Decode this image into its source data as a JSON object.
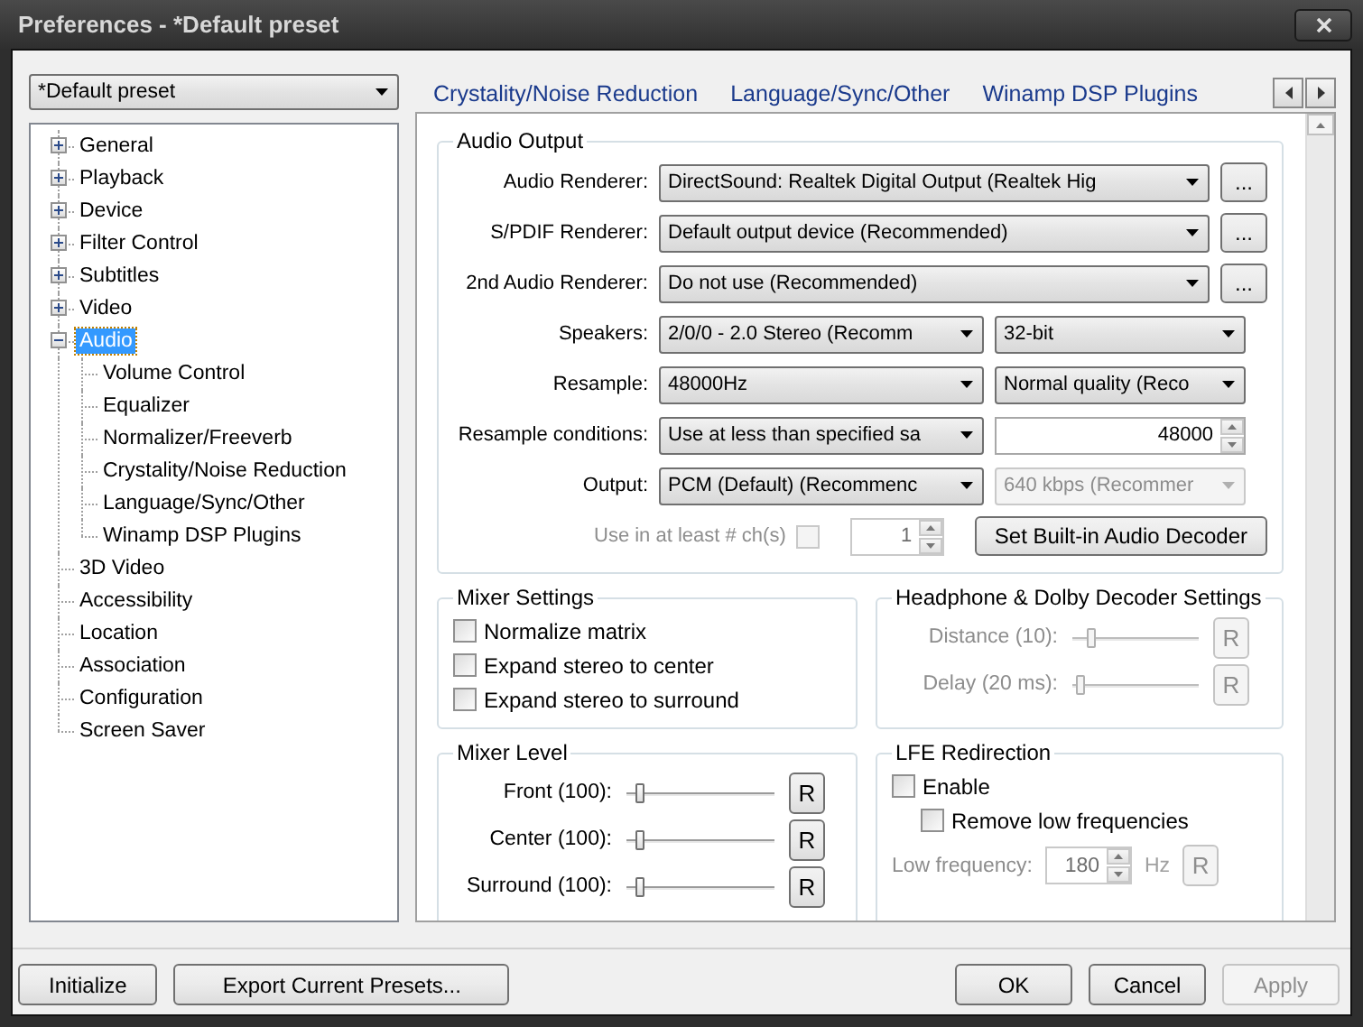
{
  "window": {
    "title": "Preferences - *Default preset"
  },
  "preset_select": {
    "value": "*Default preset"
  },
  "tree": [
    {
      "label": "General",
      "expanded": false,
      "selected": false
    },
    {
      "label": "Playback",
      "expanded": false,
      "selected": false
    },
    {
      "label": "Device",
      "expanded": false,
      "selected": false
    },
    {
      "label": "Filter Control",
      "expanded": false,
      "selected": false
    },
    {
      "label": "Subtitles",
      "expanded": false,
      "selected": false
    },
    {
      "label": "Video",
      "expanded": false,
      "selected": false
    },
    {
      "label": "Audio",
      "expanded": true,
      "selected": true,
      "children": [
        {
          "label": "Volume Control",
          "selected": false
        },
        {
          "label": "Equalizer",
          "selected": false
        },
        {
          "label": "Normalizer/Freeverb",
          "selected": false
        },
        {
          "label": "Crystality/Noise Reduction",
          "selected": false
        },
        {
          "label": "Language/Sync/Other",
          "selected": false
        },
        {
          "label": "Winamp DSP Plugins",
          "selected": false
        }
      ]
    },
    {
      "label": "3D Video",
      "selected": false
    },
    {
      "label": "Accessibility",
      "selected": false
    },
    {
      "label": "Location",
      "selected": false
    },
    {
      "label": "Association",
      "selected": false
    },
    {
      "label": "Configuration",
      "selected": false
    },
    {
      "label": "Screen Saver",
      "selected": false
    }
  ],
  "page_links": [
    "Crystality/Noise Reduction",
    "Language/Sync/Other",
    "Winamp DSP Plugins"
  ],
  "audio_output": {
    "title": "Audio Output",
    "rows": [
      {
        "label": "Audio Renderer:",
        "disabled": false,
        "controls": [
          {
            "kind": "select",
            "value": "DirectSound: Realtek Digital Output (Realtek Hig",
            "disabled": false
          },
          {
            "kind": "more_button",
            "value": "...",
            "disabled": false
          }
        ]
      },
      {
        "label": "S/PDIF Renderer:",
        "disabled": false,
        "controls": [
          {
            "kind": "select",
            "value": "Default output device (Recommended)",
            "disabled": false
          },
          {
            "kind": "more_button",
            "value": "...",
            "disabled": false
          }
        ]
      },
      {
        "label": "2nd Audio Renderer:",
        "disabled": false,
        "controls": [
          {
            "kind": "select",
            "value": "Do not use (Recommended)",
            "disabled": false
          },
          {
            "kind": "more_button",
            "value": "...",
            "disabled": false
          }
        ]
      },
      {
        "label": "Speakers:",
        "disabled": false,
        "controls": [
          {
            "kind": "select",
            "value": "2/0/0 - 2.0 Stereo (Recomm",
            "disabled": false
          },
          {
            "kind": "select",
            "value": "32-bit",
            "disabled": false
          }
        ]
      },
      {
        "label": "Resample:",
        "disabled": false,
        "controls": [
          {
            "kind": "select",
            "value": "48000Hz",
            "disabled": false
          },
          {
            "kind": "select",
            "value": "Normal quality (Reco",
            "disabled": false
          }
        ]
      },
      {
        "label": "Resample conditions:",
        "disabled": false,
        "controls": [
          {
            "kind": "select",
            "value": "Use at less than specified sa",
            "disabled": false
          },
          {
            "kind": "spin",
            "value": "48000",
            "disabled": false
          }
        ]
      },
      {
        "label": "Output:",
        "disabled": false,
        "controls": [
          {
            "kind": "select",
            "value": "PCM (Default) (Recommenc",
            "disabled": false
          },
          {
            "kind": "select",
            "value": "640 kbps (Recommer",
            "disabled": true
          }
        ]
      },
      {
        "label": "Use in at least # ch(s)",
        "disabled": true,
        "controls": [
          {
            "kind": "checkbox",
            "checked": false,
            "disabled": true
          },
          {
            "kind": "spin",
            "value": "1",
            "disabled": true
          },
          {
            "kind": "button",
            "value": "Set Built-in Audio Decoder",
            "disabled": false
          }
        ]
      }
    ]
  },
  "mixer_settings": {
    "title": "Mixer Settings",
    "options": [
      {
        "label": "Normalize matrix",
        "checked": false
      },
      {
        "label": "Expand stereo to center",
        "checked": false
      },
      {
        "label": "Expand stereo to surround",
        "checked": false
      }
    ]
  },
  "headphone_dolby": {
    "title": "Headphone & Dolby Decoder Settings",
    "disabled": true,
    "sliders": [
      {
        "label": "Distance (10):",
        "level": 0.12,
        "reset": "R"
      },
      {
        "label": "Delay (20 ms):",
        "level": 0.03,
        "reset": "R"
      }
    ]
  },
  "mixer_level": {
    "title": "Mixer Level",
    "disabled": false,
    "sliders": [
      {
        "label": "Front (100):",
        "level": 0.06,
        "reset": "R"
      },
      {
        "label": "Center (100):",
        "level": 0.06,
        "reset": "R"
      },
      {
        "label": "Surround (100):",
        "level": 0.06,
        "reset": "R"
      }
    ]
  },
  "lfe_redirection": {
    "title": "LFE Redirection",
    "enable": {
      "label": "Enable",
      "checked": false
    },
    "remove_low": {
      "label": "Remove low frequencies",
      "checked": false
    },
    "low_frequency": {
      "label": "Low frequency:",
      "value": "180",
      "unit": "Hz",
      "reset": "R",
      "disabled": true
    }
  },
  "footer": {
    "left": [
      {
        "label": "Initialize",
        "disabled": false
      },
      {
        "label": "Export Current Presets...",
        "disabled": false
      }
    ],
    "right": [
      {
        "label": "OK",
        "disabled": false
      },
      {
        "label": "Cancel",
        "disabled": false
      },
      {
        "label": "Apply",
        "disabled": true
      }
    ]
  }
}
